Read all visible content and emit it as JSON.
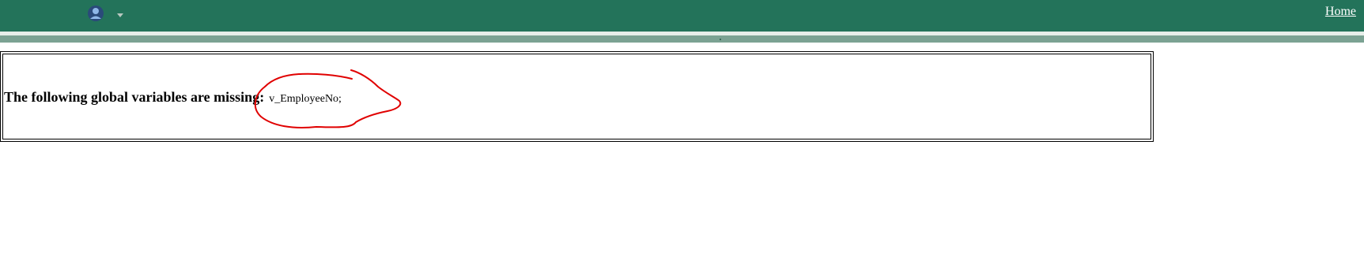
{
  "header": {
    "user_menu_icon": "user-avatar-icon",
    "dropdown_icon": "chevron-down-icon",
    "home_link": "Home"
  },
  "message": {
    "label": "The following global variables are missing:",
    "value": "v_EmployeeNo;"
  },
  "annotation": {
    "type": "hand-drawn circle",
    "color": "#e00000"
  },
  "colors": {
    "header_bg": "#23735a",
    "band": "#7ba293"
  }
}
